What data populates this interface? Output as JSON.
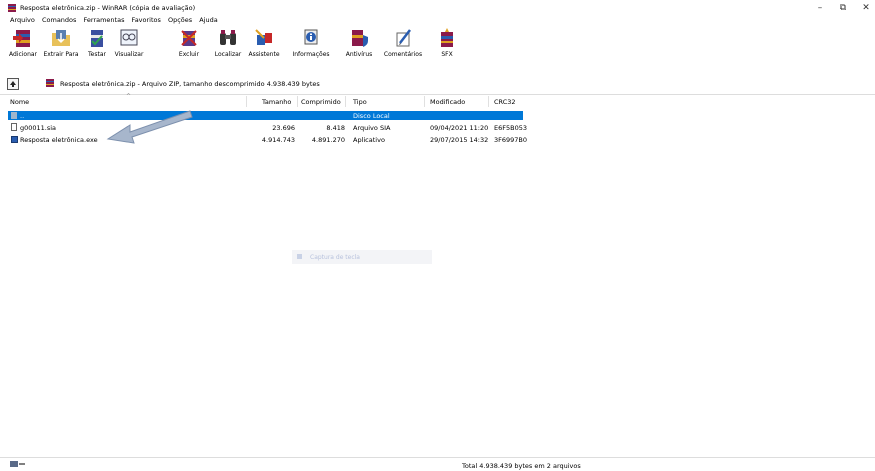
{
  "window": {
    "title": "Resposta eletrônica.zip - WinRAR (cópia de avaliação)",
    "minimize": "–",
    "maximize": "⧉",
    "close": "✕"
  },
  "menu": [
    "Arquivo",
    "Comandos",
    "Ferramentas",
    "Favoritos",
    "Opções",
    "Ajuda"
  ],
  "toolbar": {
    "add": "Adicionar",
    "extract": "Extrair Para",
    "test": "Testar",
    "view": "Visualizar",
    "delete": "Excluir",
    "find": "Localizar",
    "wizard": "Assistente",
    "info": "Informações",
    "antivirus": "Antivírus",
    "comment": "Comentários",
    "sfx": "SFX"
  },
  "path": "Resposta eletrônica.zip - Arquivo ZIP, tamanho descomprimido 4.938.439 bytes",
  "columns": {
    "name": "Nome",
    "size": "Tamanho",
    "packed": "Comprimido",
    "type": "Tipo",
    "modified": "Modificado",
    "crc": "CRC32"
  },
  "parent_row": {
    "name": "..",
    "type": "Disco Local"
  },
  "files": [
    {
      "name": "g00011.sia",
      "size": "23.696",
      "packed": "8.418",
      "type": "Arquivo SIA",
      "modified": "09/04/2021 11:20",
      "crc": "E6F5B053"
    },
    {
      "name": "Resposta eletrônica.exe",
      "size": "4.914.743",
      "packed": "4.891.270",
      "type": "Aplicativo",
      "modified": "29/07/2015 14:32",
      "crc": "3F6997B0"
    }
  ],
  "ghost_label": "Captura de tecla",
  "status": "Total 4.938.439 bytes em 2 arquivos",
  "colors": {
    "selection": "#0078d7",
    "arrow": "#a7b6cc"
  }
}
